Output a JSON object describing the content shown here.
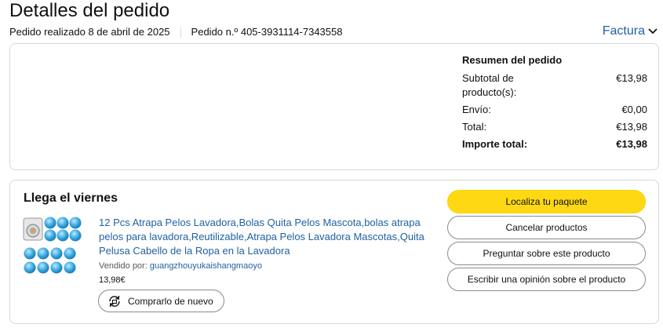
{
  "page": {
    "title": "Detalles del pedido"
  },
  "meta": {
    "placed": "Pedido realizado 8 de abril de 2025",
    "order_number": "Pedido n.º 405-3931114-7343558"
  },
  "invoice": {
    "label": "Factura"
  },
  "summary": {
    "heading": "Resumen del pedido",
    "rows": [
      {
        "label": "Subtotal de producto(s):",
        "value": "€13,98"
      },
      {
        "label": "Envío:",
        "value": "€0,00"
      },
      {
        "label": "Total:",
        "value": "€13,98"
      }
    ],
    "grand_total": {
      "label": "Importe total:",
      "value": "€13,98"
    }
  },
  "shipment": {
    "status": "Llega el viernes",
    "product": {
      "title": "12 Pcs Atrapa Pelos Lavadora,Bolas Quita Pelos Mascota,bolas atrapa pelos para lavadora,Reutilizable,Atrapa Pelos Lavadora Mascotas,Quita Pelusa Cabello de la Ropa en la Lavadora",
      "seller_prefix": "Vendido por:",
      "seller": "guangzhouyukaishangmaoyo",
      "price": "13,98€",
      "rebuy_label": "Comprarlo de nuevo"
    },
    "actions": {
      "track": "Localiza tu paquete",
      "cancel": "Cancelar productos",
      "ask": "Preguntar sobre este producto",
      "review": "Escribir una opinión sobre el producto"
    }
  },
  "colors": {
    "link": "#2162a1",
    "primary_button": "#ffd814",
    "border": "#d5d9d9"
  },
  "icons": {
    "invoice_chevron": "chevron-down-icon",
    "rebuy": "refresh-icon"
  }
}
